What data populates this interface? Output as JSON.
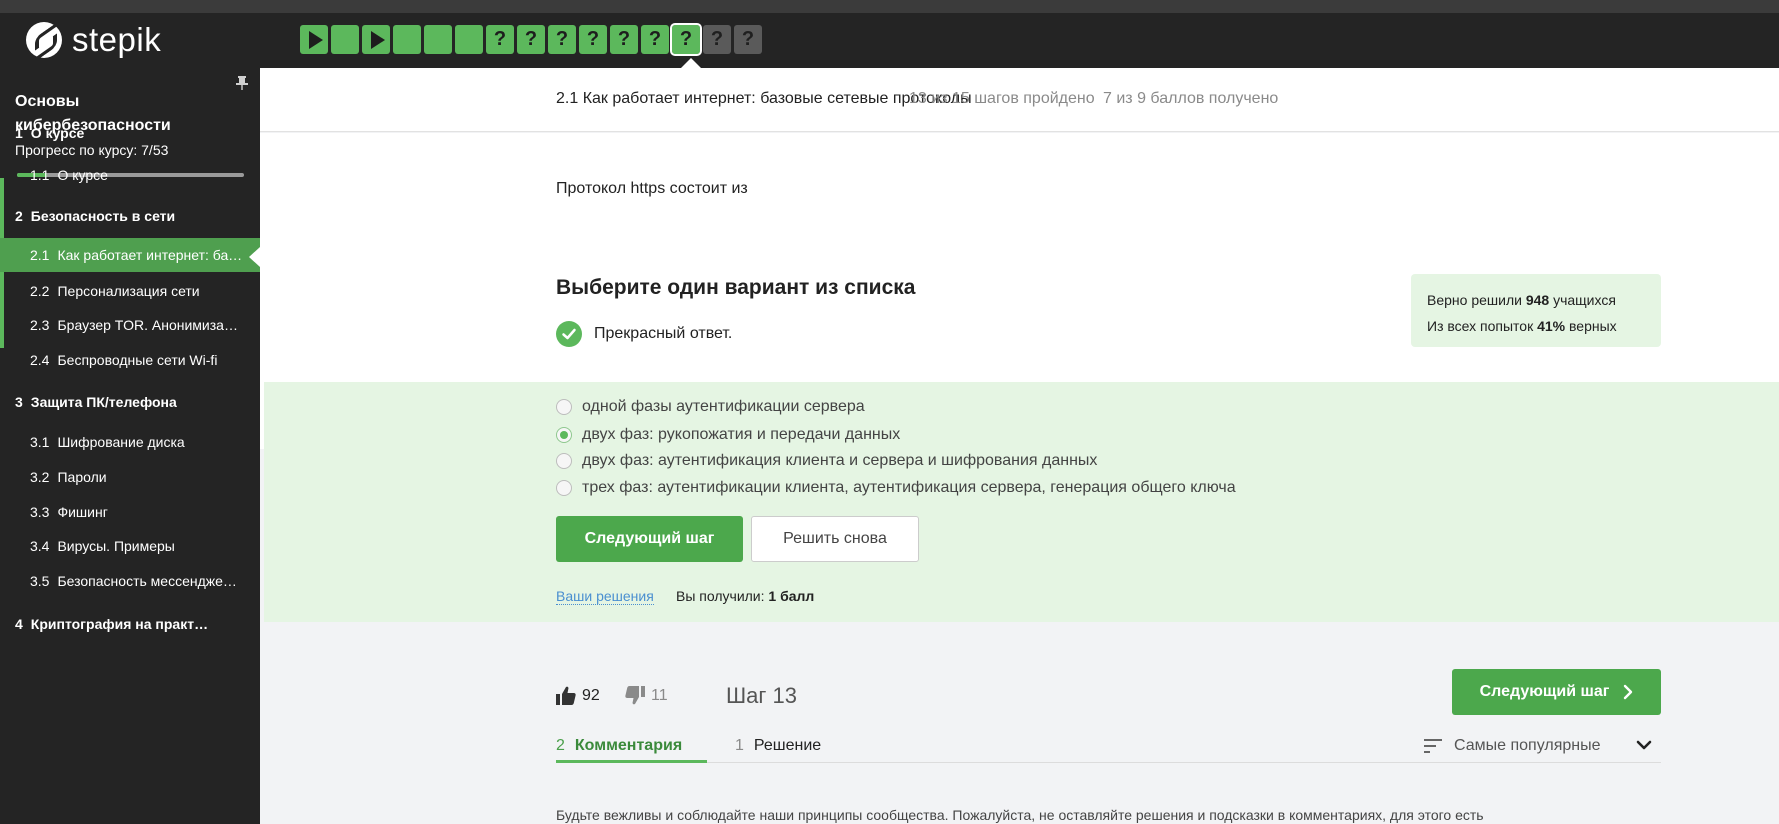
{
  "brand": {
    "name": "stepik"
  },
  "step_nav": {
    "steps": [
      {
        "kind": "play",
        "state": "done"
      },
      {
        "kind": "text",
        "state": "done"
      },
      {
        "kind": "play",
        "state": "done"
      },
      {
        "kind": "text",
        "state": "done"
      },
      {
        "kind": "text",
        "state": "done"
      },
      {
        "kind": "text",
        "state": "done"
      },
      {
        "kind": "quiz",
        "state": "done"
      },
      {
        "kind": "quiz",
        "state": "done"
      },
      {
        "kind": "quiz",
        "state": "done"
      },
      {
        "kind": "quiz",
        "state": "done"
      },
      {
        "kind": "quiz",
        "state": "done"
      },
      {
        "kind": "quiz",
        "state": "done"
      },
      {
        "kind": "quiz",
        "state": "current"
      },
      {
        "kind": "quiz",
        "state": "todo"
      },
      {
        "kind": "quiz",
        "state": "todo"
      }
    ],
    "quiz_glyph": "?"
  },
  "sidebar": {
    "course_title": "Основы кибербезопасности",
    "progress_label": "Прогресс по курсу:  7/53",
    "progress_fraction": 0.132,
    "items": [
      {
        "num": "1",
        "label": "О курсе",
        "type": "section"
      },
      {
        "num": "1.1",
        "label": "О курсе",
        "type": "lesson"
      },
      {
        "num": "2",
        "label": "Безопасность в сети",
        "type": "section"
      },
      {
        "num": "2.1",
        "label": "Как работает интернет: базовые сетевые протоколы",
        "type": "lesson",
        "active": true
      },
      {
        "num": "2.2",
        "label": "Персонализация сети",
        "type": "lesson"
      },
      {
        "num": "2.3",
        "label": "Браузер TOR. Анонимизация в сети",
        "type": "lesson"
      },
      {
        "num": "2.4",
        "label": "Беспроводные сети Wi-fi",
        "type": "lesson"
      },
      {
        "num": "3",
        "label": "Защита ПК/телефона",
        "type": "section"
      },
      {
        "num": "3.1",
        "label": "Шифрование диска",
        "type": "lesson"
      },
      {
        "num": "3.2",
        "label": "Пароли",
        "type": "lesson"
      },
      {
        "num": "3.3",
        "label": "Фишинг",
        "type": "lesson"
      },
      {
        "num": "3.4",
        "label": "Вирусы. Примеры",
        "type": "lesson"
      },
      {
        "num": "3.5",
        "label": "Безопасность мессенджеров",
        "type": "lesson"
      },
      {
        "num": "4",
        "label": "Криптография на практике",
        "type": "section"
      }
    ]
  },
  "header": {
    "lesson_title": "2.1 Как работает интернет: базовые сетевые протоколы",
    "steps_progress": "13 из 15 шагов пройдено",
    "points_progress": "7 из 9 баллов  получено"
  },
  "quiz": {
    "question": "Протокол https состоит из",
    "instruction": "Выберите один вариант из списка",
    "feedback": "Прекрасный ответ.",
    "stats": {
      "solved_prefix": "Верно решили ",
      "solved_count": "948",
      "solved_suffix": " учащихся",
      "attempts_prefix": "Из всех попыток ",
      "attempts_percent": "41%",
      "attempts_suffix": " верных"
    },
    "options": [
      {
        "text": "одной фазы аутентификации сервера",
        "checked": false
      },
      {
        "text": "двух фаз: рукопожатия и передачи данных",
        "checked": true
      },
      {
        "text": "двух фаз: аутентификация клиента и сервера и шифрования данных",
        "checked": false
      },
      {
        "text": "трех фаз: аутентификации клиента, аутентификация сервера, генерация общего ключа",
        "checked": false
      }
    ],
    "next_button": "Следующий шаг",
    "retry_button": "Решить снова",
    "solutions_link": "Ваши решения",
    "score_prefix": "Вы получили: ",
    "score_value": "1 балл"
  },
  "footer": {
    "likes": "92",
    "dislikes": "11",
    "step_label": "Шаг 13",
    "next_button": "Следующий шаг",
    "tabs": [
      {
        "count": "2",
        "name": "Комментария",
        "active": true
      },
      {
        "count": "1",
        "name": "Решение",
        "active": false
      }
    ],
    "sort_label": "Самые популярные",
    "cut_text": "Будьте вежливы и соблюдайте наши принципы сообщества. Пожалуйста, не оставляйте решения и подсказки в комментариях, для этого есть"
  }
}
